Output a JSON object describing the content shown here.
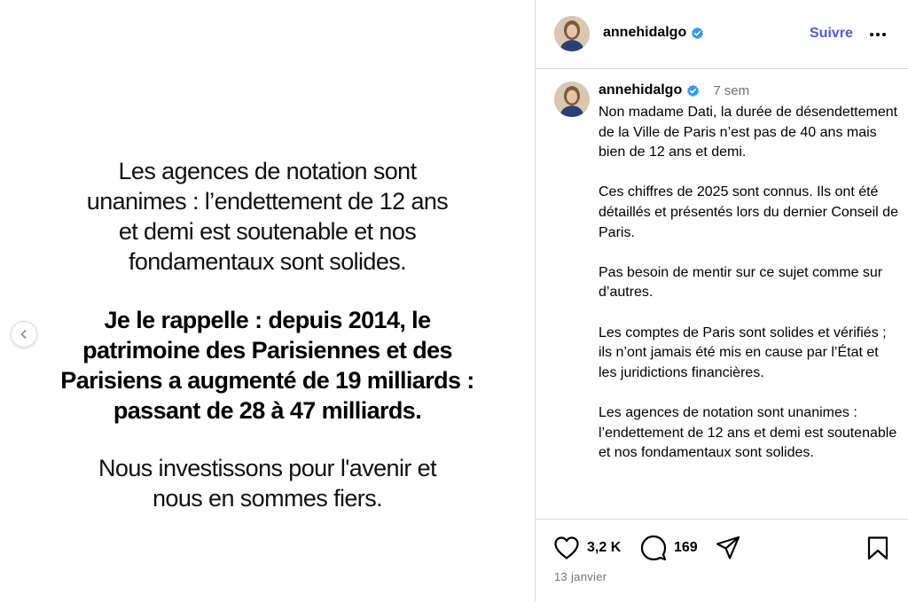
{
  "media": {
    "paragraph1": "Les agences de notation sont\nunanimes : l’endettement de 12 ans\net demi est soutenable et nos\nfondamentaux sont solides.",
    "paragraph2": "Je le rappelle : depuis 2014, le\npatrimoine des Parisiennes et des\nParisiens a augmenté de 19 milliards :\npassant de 28 à 47 milliards.",
    "paragraph3": "Nous investissons pour l'avenir et\nnous en sommes fiers.",
    "prev_icon": "chevron-left-icon"
  },
  "header": {
    "username": "annehidalgo",
    "follow_label": "Suivre",
    "more_icon": "more-horizontal-icon",
    "verified_icon": "verified-badge-icon"
  },
  "caption": {
    "username": "annehidalgo",
    "time": "7 sem",
    "text": "Non madame Dati, la durée de désendettement de la Ville de Paris n’est pas de 40 ans mais bien de 12 ans et demi.\n\nCes chiffres de 2025 sont connus. Ils ont été détaillés et présentés lors du dernier Conseil de Paris.\n\nPas besoin de mentir sur ce sujet comme sur d’autres.\n\nLes comptes de Paris sont solides et vérifiés ; ils n’ont jamais été mis en cause par l’État et les juridictions financières.\n\nLes agences de notation sont unanimes : l’endettement de 12 ans et demi est soutenable et nos fondamentaux sont solides."
  },
  "actions": {
    "likes": "3,2 K",
    "comments": "169",
    "date": "13 janvier",
    "icons": [
      "heart-icon",
      "comment-icon",
      "share-icon",
      "bookmark-icon"
    ]
  },
  "colors": {
    "follow": "#4f5bd5",
    "verified": "#3897f0",
    "muted": "#737373",
    "border": "#dbdbdb"
  }
}
